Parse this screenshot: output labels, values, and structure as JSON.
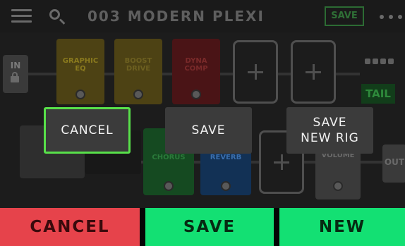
{
  "header": {
    "preset_name": "003 MODERN PLEXI",
    "save_label": "SAVE"
  },
  "signal_path": {
    "input_label": "IN",
    "blocks": [
      {
        "label": "GRAPHIC\nEQ",
        "color": "#4d4214",
        "text_color": "#8a7a1e"
      },
      {
        "label": "BOOST\nDRIVE",
        "color": "#4d4214",
        "text_color": "#6d6020"
      },
      {
        "label": "DYNA\nCOMP",
        "color": "#4a1416",
        "text_color": "#7a2a2a"
      },
      {
        "label": "CHORUS",
        "color": "#154a21",
        "text_color": "#2a7a3a"
      },
      {
        "label": "REVERB",
        "color": "#123155",
        "text_color": "#3a6fae"
      },
      {
        "label": "VOLUME",
        "color": "#3a3a3a",
        "text_color": "#6a6a6a"
      }
    ],
    "tail_label": "TAIL",
    "output_label": "OUT"
  },
  "dialog": {
    "cancel_label": "CANCEL",
    "save_label": "SAVE",
    "save_new_label": "SAVE\nNEW RIG"
  },
  "bottom_bar": {
    "cancel_label": "CANCEL",
    "save_label": "SAVE",
    "new_label": "NEW"
  },
  "colors": {
    "cancel_red": "#e6434b",
    "confirm_green": "#13e073",
    "focus_outline": "#58e04a",
    "dialog_button": "#3b3b3b"
  }
}
